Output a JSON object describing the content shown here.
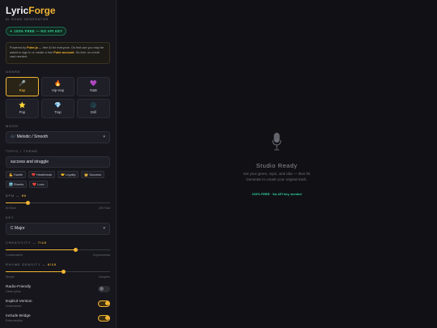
{
  "brand": {
    "name_a": "Lyric",
    "name_b": "Forge",
    "subtitle": "AI SONG GENERATOR"
  },
  "badge": "✦ 100% FREE — NO API KEY",
  "info": {
    "p1": "Powered by ",
    "p2": "Puter.js",
    "p3": " — free AI for everyone. On first use you may be asked to sign in or create a free ",
    "p4": "Puter account",
    "p5": ". It's free, no credit card needed."
  },
  "genre": {
    "label": "GENRE",
    "items": [
      {
        "icon": "🎤",
        "label": "Rap",
        "icon_name": "microphone-icon"
      },
      {
        "icon": "🔥",
        "label": "Hip-Hop",
        "icon_name": "fire-icon"
      },
      {
        "icon": "💜",
        "label": "R&B",
        "icon_name": "purple-heart-icon"
      },
      {
        "icon": "⭐",
        "label": "Pop",
        "icon_name": "star-icon"
      },
      {
        "icon": "💎",
        "label": "Trap",
        "icon_name": "gem-icon"
      },
      {
        "icon": "🌑",
        "label": "Drill",
        "icon_name": "dark-moon-icon"
      }
    ],
    "selected": "Rap"
  },
  "mood": {
    "label": "MOOD",
    "value": "🎶 Melodic / Smooth"
  },
  "topic": {
    "label": "TOPIC / THEME",
    "value": "success and struggle",
    "chips": [
      "💪 Hustle",
      "💔 Heartbreak",
      "🤝 Loyalty",
      "👑 Success",
      "🏙️ Streets",
      "❤️ Love"
    ]
  },
  "bpm": {
    "label": "BPM — ",
    "value": "90",
    "min_label": "60 Slow",
    "max_label": "200 Fast",
    "min": 60,
    "max": 200,
    "current": 90
  },
  "key": {
    "label": "KEY",
    "value": "C Major"
  },
  "creativity": {
    "label": "CREATIVITY — ",
    "value": "7/10",
    "min_label": "Conservative",
    "max_label": "Experimental",
    "min": 1,
    "max": 10,
    "current": 7
  },
  "rhyme": {
    "label": "RHYME DENSITY — ",
    "value": "6/10",
    "min_label": "Simple",
    "max_label": "Complex",
    "min": 1,
    "max": 10,
    "current": 6
  },
  "toggles": [
    {
      "title": "Radio-Friendly",
      "sub": "Clean lyrics",
      "on": false
    },
    {
      "title": "Explicit Version",
      "sub": "Uncensored",
      "on": true
    },
    {
      "title": "Include Bridge",
      "sub": "Extra section",
      "on": true
    }
  ],
  "main": {
    "title": "Studio Ready",
    "desc1": "Set your genre, topic, and vibe — then hit",
    "desc2": "Generate to create your original track.",
    "free": "100% FREE · No API key needed"
  },
  "colors": {
    "accent": "#f2b534",
    "free": "#2fd39a",
    "bg": "#0f0f13"
  }
}
